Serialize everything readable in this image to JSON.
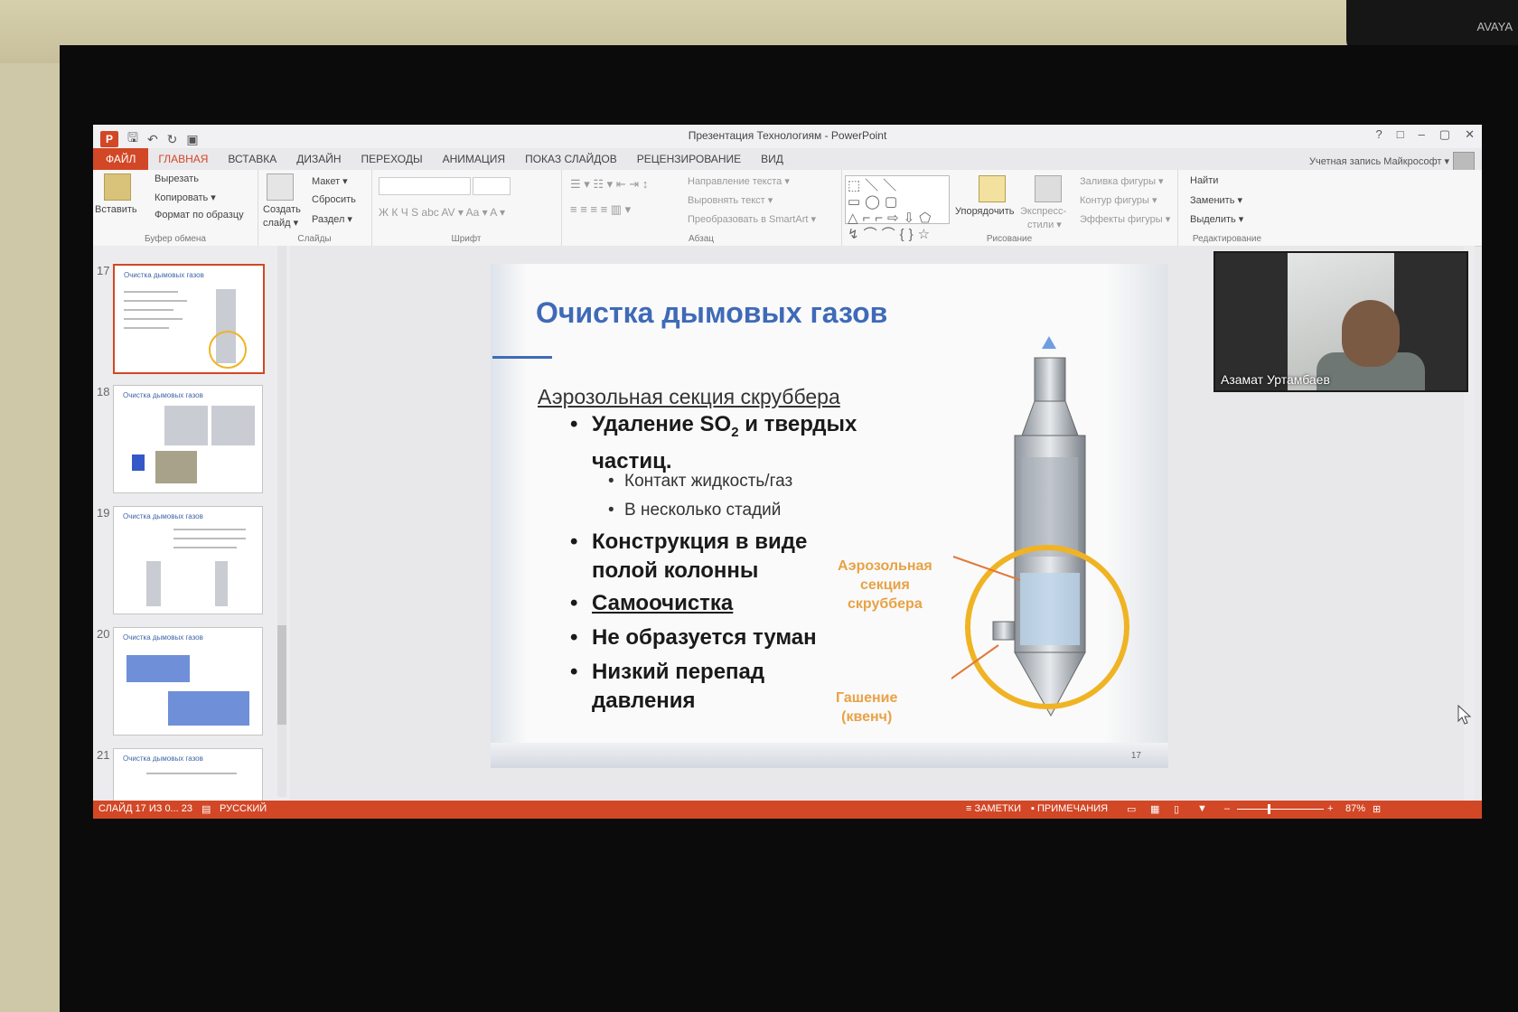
{
  "camera": {
    "brand": "AVAYA"
  },
  "window": {
    "title": "Презентация Технологиям - PowerPoint",
    "controls": [
      "?",
      "□",
      "–",
      "▢",
      "✕"
    ]
  },
  "account": {
    "label": "Учетная запись Майкрософт ▾"
  },
  "tabs": [
    "ФАЙЛ",
    "ГЛАВНАЯ",
    "ВСТАВКА",
    "ДИЗАЙН",
    "ПЕРЕХОДЫ",
    "АНИМАЦИЯ",
    "ПОКАЗ СЛАЙДОВ",
    "РЕЦЕНЗИРОВАНИЕ",
    "ВИД"
  ],
  "ribbon": {
    "clipboard": {
      "paste": "Вставить",
      "cut": "Вырезать",
      "copy": "Копировать ▾",
      "format": "Формат по образцу",
      "label": "Буфер обмена"
    },
    "slides": {
      "new_slide": "Создать",
      "new_slide2": "слайд ▾",
      "layout": "Макет ▾",
      "reset": "Сбросить",
      "section": "Раздел ▾",
      "label": "Слайды"
    },
    "font": {
      "row": "Ж  К  Ч  S  abc  AV ▾  Aa ▾   A ▾",
      "label": "Шрифт"
    },
    "paragraph": {
      "direction": "Направление текста ▾",
      "align": "Выровнять текст ▾",
      "smartart": "Преобразовать в SmartArt ▾",
      "label": "Абзац"
    },
    "drawing": {
      "arrange": "Упорядочить",
      "styles": "Экспресс-",
      "styles2": "стили ▾",
      "fill": "Заливка фигуры ▾",
      "outline": "Контур фигуры ▾",
      "effects": "Эффекты фигуры ▾",
      "label": "Рисование",
      "shapes_row1": "⬚＼＼▭◯▢",
      "shapes_row2": "△⌐⌐⇨⇩⬠",
      "shapes_row3": "↯⌒⌒{}☆"
    },
    "editing": {
      "find": "Найти",
      "replace": "Заменить ▾",
      "select": "Выделить ▾",
      "label": "Редактирование"
    }
  },
  "thumbnails": [
    {
      "num": "17",
      "title": "Очистка дымовых газов",
      "selected": true
    },
    {
      "num": "18",
      "title": "Очистка дымовых газов",
      "selected": false
    },
    {
      "num": "19",
      "title": "Очистка дымовых газов",
      "selected": false
    },
    {
      "num": "20",
      "title": "Очистка дымовых газов",
      "selected": false
    },
    {
      "num": "21",
      "title": "Очистка дымовых газов",
      "selected": false
    }
  ],
  "slide": {
    "title": "Очистка дымовых газов",
    "subtitle": "Аэрозольная секция скруббера",
    "b1_line1": "Удаление SO",
    "b1_sub": "2",
    "b1_rest": " и твердых",
    "b1_line2": "частиц.",
    "s1": "Контакт жидкость/газ",
    "s2": "В несколько стадий",
    "b2_line1": "Конструкция в виде",
    "b2_line2": "полой колонны",
    "b3": "Самоочистка",
    "b4": "Не образуется туман",
    "b5_line1": "Низкий перепад",
    "b5_line2": "давления",
    "label_aerosol_1": "Аэрозольная",
    "label_aerosol_2": "секция",
    "label_aerosol_3": "скруббера",
    "label_quench_1": "Гашение",
    "label_quench_2": "(квенч)",
    "page_number": "17"
  },
  "video": {
    "participant": "Азамат Уртамбаев"
  },
  "status": {
    "slide_info": "СЛАЙД 17 ИЗ 0... 23",
    "language": "РУССКИЙ",
    "notes": "ЗАМЕТКИ",
    "comments": "ПРИМЕЧАНИЯ",
    "zoom": "87%"
  },
  "colors": {
    "accent": "#d24726",
    "title_blue": "#3f6ab8",
    "highlight_ring": "#f0b323",
    "label_orange": "#e8a246"
  }
}
